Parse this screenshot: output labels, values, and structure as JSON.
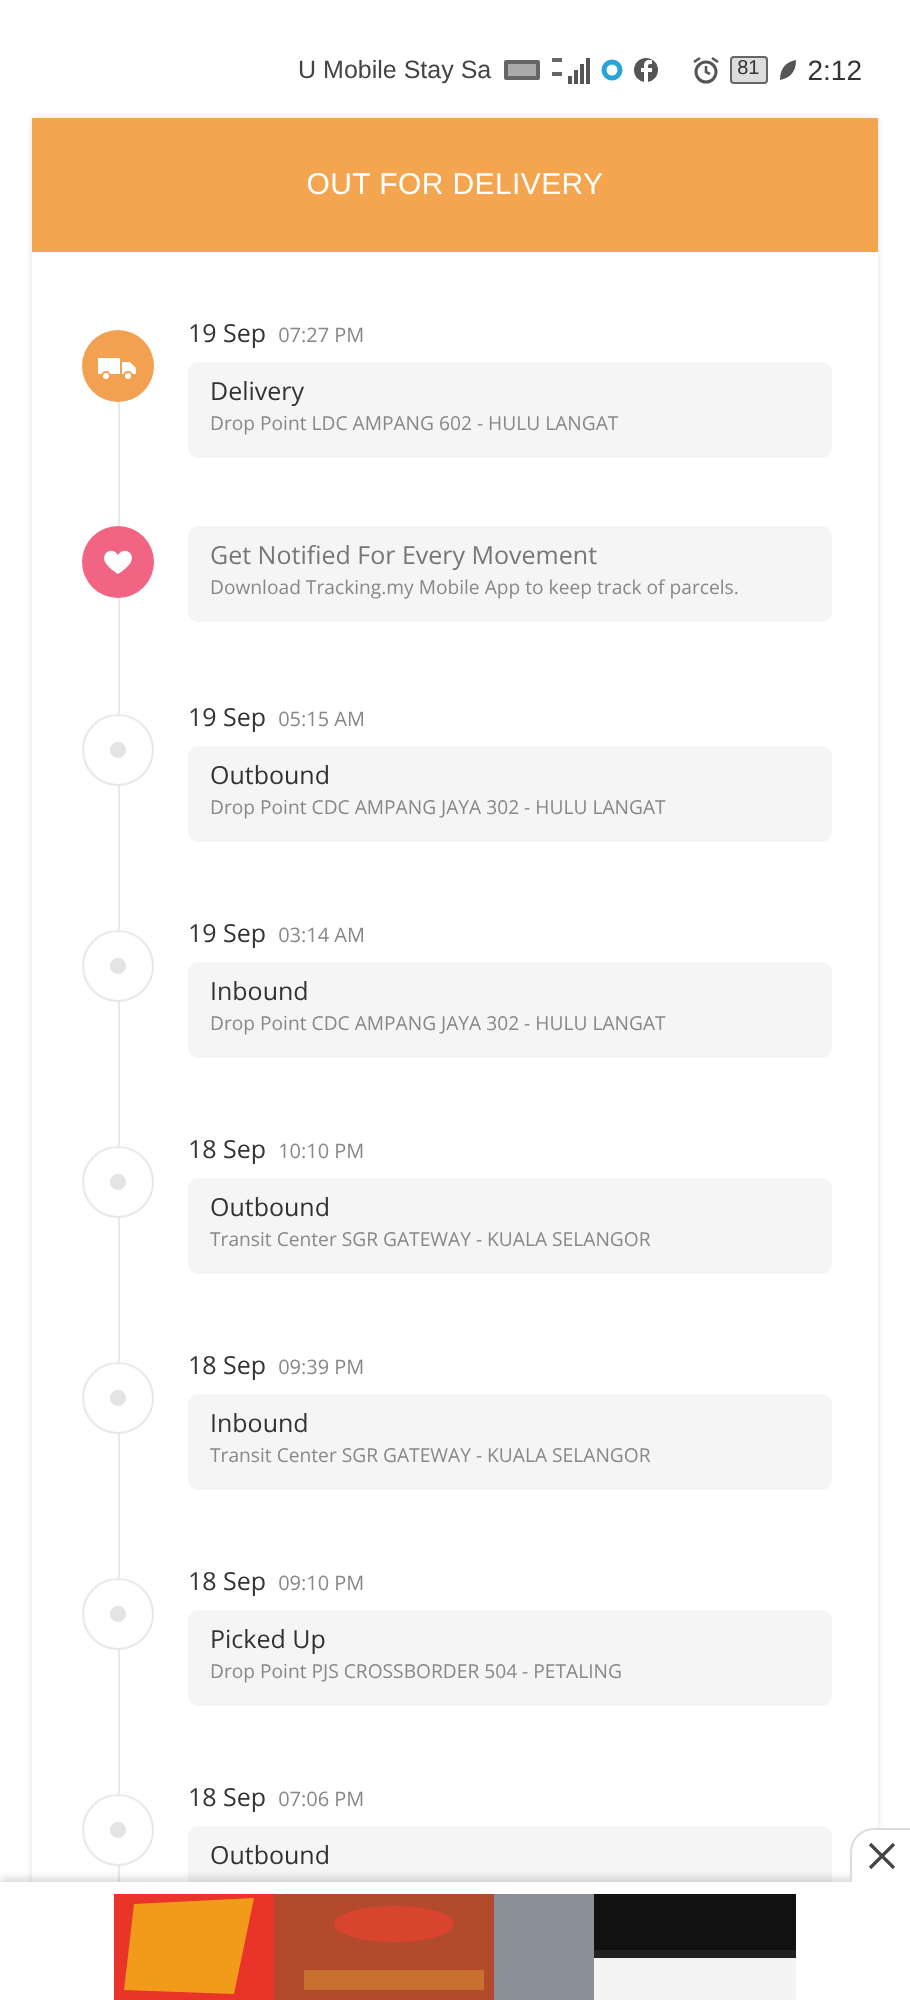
{
  "status_bar": {
    "carrier": "U Mobile Stay Sa",
    "battery": "81",
    "time": "2:12"
  },
  "header": {
    "title": "OUT FOR DELIVERY"
  },
  "events": [
    {
      "kind": "current",
      "date": "19 Sep",
      "time": "07:27 PM",
      "title": "Delivery",
      "detail": "Drop Point LDC AMPANG 602 - HULU LANGAT"
    },
    {
      "kind": "promo",
      "title": "Get Notified For Every Movement",
      "detail": "Download Tracking.my Mobile App to keep track of parcels."
    },
    {
      "kind": "event",
      "date": "19 Sep",
      "time": "05:15 AM",
      "title": "Outbound",
      "detail": "Drop Point CDC AMPANG JAYA 302 - HULU LANGAT"
    },
    {
      "kind": "event",
      "date": "19 Sep",
      "time": "03:14 AM",
      "title": "Inbound",
      "detail": "Drop Point CDC AMPANG JAYA 302 - HULU LANGAT"
    },
    {
      "kind": "event",
      "date": "18 Sep",
      "time": "10:10 PM",
      "title": "Outbound",
      "detail": "Transit Center SGR GATEWAY - KUALA SELANGOR"
    },
    {
      "kind": "event",
      "date": "18 Sep",
      "time": "09:39 PM",
      "title": "Inbound",
      "detail": "Transit Center SGR GATEWAY - KUALA SELANGOR"
    },
    {
      "kind": "event",
      "date": "18 Sep",
      "time": "09:10 PM",
      "title": "Picked Up",
      "detail": "Drop Point PJS CROSSBORDER 504 - PETALING"
    },
    {
      "kind": "event",
      "date": "18 Sep",
      "time": "07:06 PM",
      "title": "Outbound"
    }
  ]
}
